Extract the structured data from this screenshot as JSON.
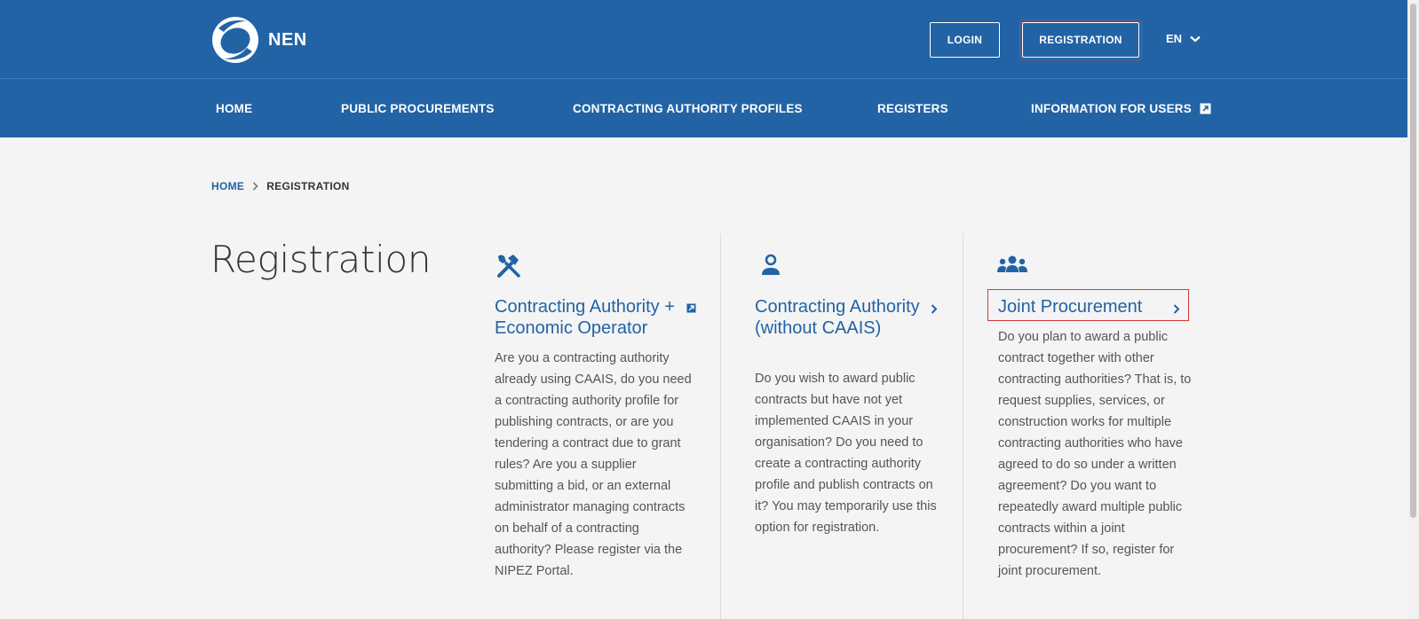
{
  "header": {
    "logo_text": "NEN",
    "login_label": "LOGIN",
    "registration_label": "REGISTRATION",
    "language": "EN"
  },
  "nav": {
    "items": [
      {
        "label": "HOME"
      },
      {
        "label": "PUBLIC PROCUREMENTS"
      },
      {
        "label": "CONTRACTING AUTHORITY PROFILES"
      },
      {
        "label": "REGISTERS"
      },
      {
        "label": "INFORMATION FOR USERS"
      }
    ]
  },
  "breadcrumb": {
    "home": "HOME",
    "current": "REGISTRATION"
  },
  "page": {
    "title": "Registration"
  },
  "cards": [
    {
      "icon": "tools-icon",
      "title": "Contracting Authority + Economic Operator",
      "arrow": "external-link-icon",
      "text": "Are you a contracting authority already using CAAIS, do you need a contracting authority profile for publishing contracts, or are you tendering a contract due to grant rules? Are you a supplier submitting a bid, or an external administrator managing contracts on behalf of a contracting authority? Please register via the NIPEZ Portal."
    },
    {
      "icon": "user-icon",
      "title": "Contracting Authority (without CAAIS)",
      "arrow": "chevron-right-icon",
      "text": "Do you wish to award public contracts but have not yet implemented CAAIS in your organisation? Do you need to create a contracting authority profile and publish contracts on it? You may temporarily use this option for registration."
    },
    {
      "icon": "group-icon",
      "title": "Joint Procurement",
      "arrow": "chevron-right-icon",
      "text": "Do you plan to award a public contract together with other contracting authorities? That is, to request supplies, services, or construction works for multiple contracting authorities who have agreed to do so under a written agreement? Do you want to repeatedly award multiple public contracts within a joint procurement? If so, register for joint procurement."
    }
  ],
  "colors": {
    "brand_blue": "#2263a5",
    "background": "#f4f4f4",
    "highlight_red": "#d33a3a"
  }
}
